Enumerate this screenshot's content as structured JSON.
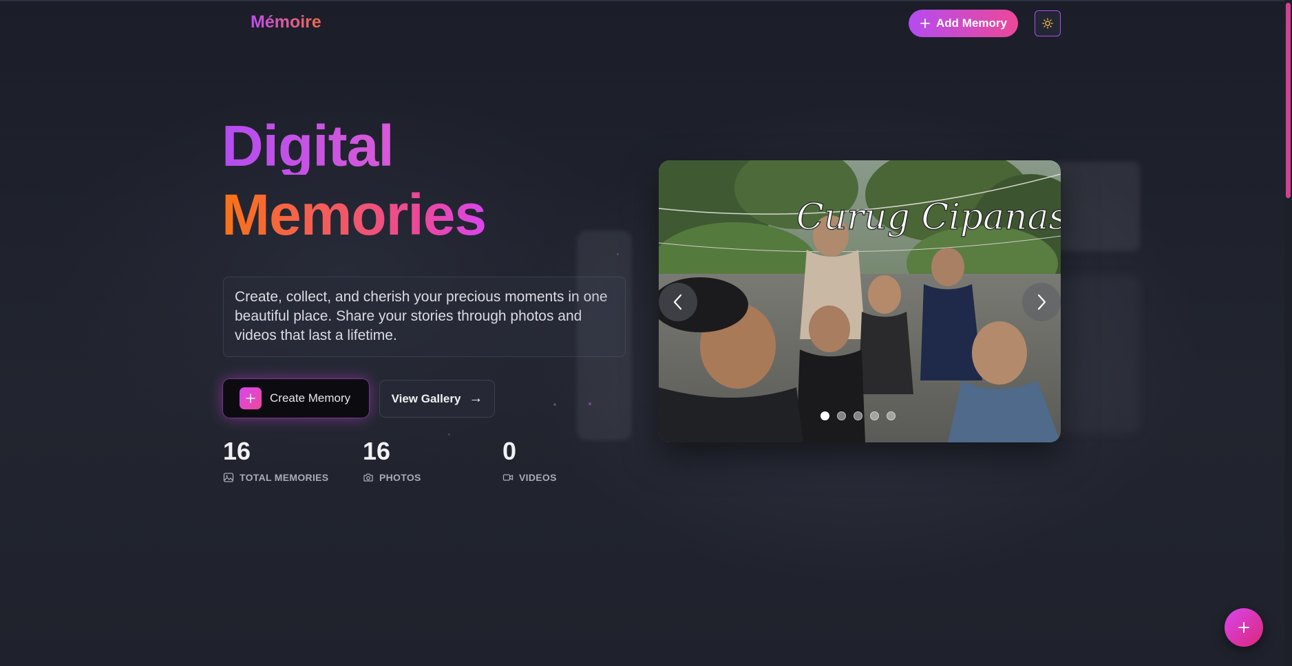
{
  "header": {
    "logo": "Mémoire",
    "add_button_label": "Add Memory",
    "theme_toggle_icon": "sun-icon"
  },
  "hero": {
    "title_line1": "Digital",
    "title_line2": "Memories",
    "description": "Create, collect, and cherish your precious moments in one beautiful place. Share your stories through photos and videos that last a lifetime.",
    "create_button_label": "Create Memory",
    "gallery_button_label": "View Gallery",
    "gallery_button_arrow": "→"
  },
  "stats": [
    {
      "value": "16",
      "label": "TOTAL MEMORIES",
      "icon": "image-icon"
    },
    {
      "value": "16",
      "label": "PHOTOS",
      "icon": "camera-icon"
    },
    {
      "value": "0",
      "label": "VIDEOS",
      "icon": "video-icon"
    }
  ],
  "carousel": {
    "photo_sign_text": "Curug Cipanas",
    "slide_count": 5,
    "active_index": 0
  },
  "colors": {
    "accent_purple": "#b44cf0",
    "accent_pink": "#ec4899",
    "accent_orange": "#f97316",
    "background": "#1c1f2a"
  }
}
